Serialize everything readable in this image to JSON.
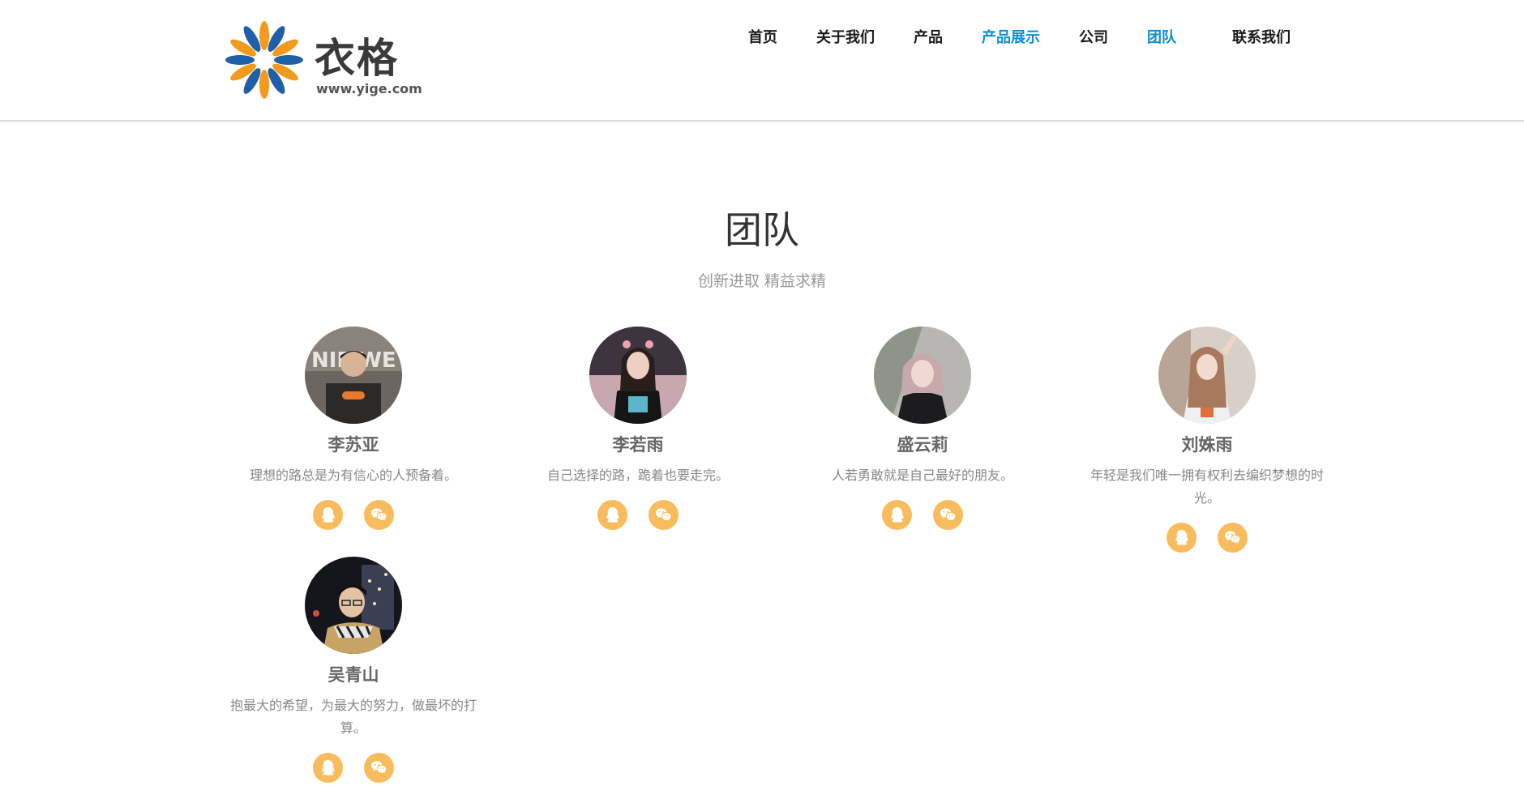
{
  "brand": {
    "name": "衣格",
    "url": "www.yige.com",
    "colors": {
      "orange": "#f29a1d",
      "blue": "#1e5fa8"
    }
  },
  "nav": {
    "items": [
      {
        "label": "首页",
        "active": false
      },
      {
        "label": "关于我们",
        "active": false
      },
      {
        "label": "产品",
        "active": false
      },
      {
        "label": "产品展示",
        "active": true
      },
      {
        "label": "公司",
        "active": false
      },
      {
        "label": "团队",
        "active": true
      },
      {
        "label": "联系我们",
        "active": false
      }
    ],
    "active_color": "#0a8fd6"
  },
  "section": {
    "title": "团队",
    "subtitle": "创新进取  精益求精"
  },
  "team": {
    "members": [
      {
        "name": "李苏亚",
        "motto": "理想的路总是为有信心的人预备着。",
        "icons": [
          "qq-icon",
          "wechat-icon"
        ]
      },
      {
        "name": "李若雨",
        "motto": "自己选择的路，跪着也要走完。",
        "icons": [
          "qq-icon",
          "wechat-icon"
        ]
      },
      {
        "name": "盛云莉",
        "motto": "人若勇敢就是自己最好的朋友。",
        "icons": [
          "qq-icon",
          "wechat-icon"
        ]
      },
      {
        "name": "刘姝雨",
        "motto": "年轻是我们唯一拥有权利去编织梦想的时光。",
        "icons": [
          "qq-icon",
          "wechat-icon"
        ]
      },
      {
        "name": "吴青山",
        "motto": "抱最大的希望，为最大的努力，做最坏的打算。",
        "icons": [
          "qq-icon",
          "wechat-icon"
        ]
      }
    ],
    "social_color": "#f9bc5c"
  }
}
